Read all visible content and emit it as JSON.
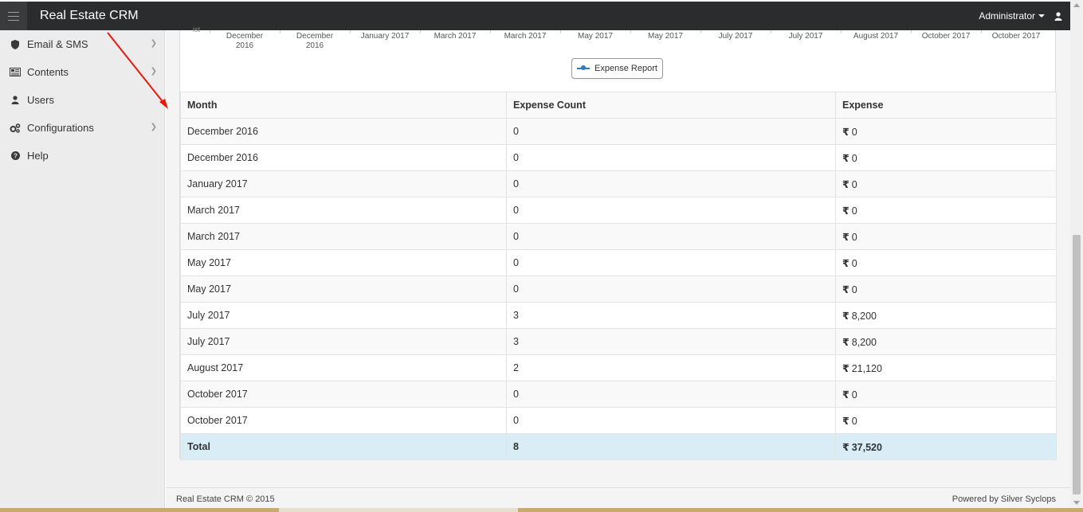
{
  "header": {
    "brand": "Real Estate CRM",
    "user_label": "Administrator"
  },
  "sidebar": {
    "items": [
      {
        "label": "Email & SMS",
        "icon": "shield-icon",
        "has_children": true
      },
      {
        "label": "Contents",
        "icon": "newspaper-icon",
        "has_children": true
      },
      {
        "label": "Users",
        "icon": "user-icon",
        "has_children": false
      },
      {
        "label": "Configurations",
        "icon": "cogs-icon",
        "has_children": true
      },
      {
        "label": "Help",
        "icon": "question-circle-icon",
        "has_children": false
      }
    ]
  },
  "chart": {
    "ylabel_fragment": "ist",
    "x_ticks": [
      "December 2016",
      "December 2016",
      "January 2017",
      "March 2017",
      "March 2017",
      "May 2017",
      "May 2017",
      "July 2017",
      "July 2017",
      "August 2017",
      "October 2017",
      "October 2017"
    ],
    "legend_label": "Expense Report",
    "series_color": "#2e7bc6"
  },
  "table": {
    "headers": [
      "Month",
      "Expense Count",
      "Expense"
    ],
    "currency_symbol": "₹",
    "rows": [
      [
        "December 2016",
        "0",
        "0"
      ],
      [
        "December 2016",
        "0",
        "0"
      ],
      [
        "January 2017",
        "0",
        "0"
      ],
      [
        "March 2017",
        "0",
        "0"
      ],
      [
        "March 2017",
        "0",
        "0"
      ],
      [
        "May 2017",
        "0",
        "0"
      ],
      [
        "May 2017",
        "0",
        "0"
      ],
      [
        "July 2017",
        "3",
        "8,200"
      ],
      [
        "July 2017",
        "3",
        "8,200"
      ],
      [
        "August 2017",
        "2",
        "21,120"
      ],
      [
        "October 2017",
        "0",
        "0"
      ],
      [
        "October 2017",
        "0",
        "0"
      ]
    ],
    "total": [
      "Total",
      "8",
      "37,520"
    ]
  },
  "footer": {
    "left": "Real Estate CRM © 2015",
    "right": "Powered by Silver Syclops"
  },
  "colors": {
    "topbar": "#2b2c2e",
    "total_row": "#d9edf7",
    "annotation_arrow": "#e8190f"
  }
}
